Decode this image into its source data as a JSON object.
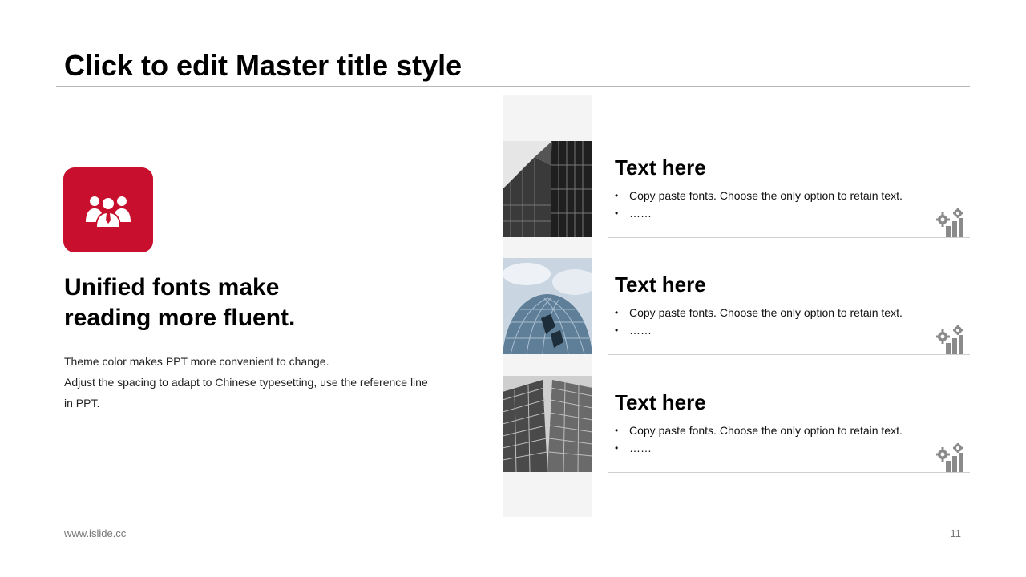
{
  "slide": {
    "title": "Click to edit Master title style",
    "accent_color": "#c8102e"
  },
  "feature": {
    "icon": "team-icon",
    "heading_lines": [
      "Unified fonts make",
      "reading more fluent."
    ],
    "body_lines": [
      "Theme color makes PPT more convenient to change.",
      "Adjust the spacing to adapt to Chinese typesetting, use the reference line",
      "in PPT."
    ]
  },
  "items": [
    {
      "title": "Text here",
      "bullets": [
        "Copy paste fonts. Choose the only option to retain text.",
        "……"
      ],
      "icon": "settings-chart-icon",
      "thumbnail": "building-photo"
    },
    {
      "title": "Text here",
      "bullets": [
        "Copy paste fonts. Choose the only option to retain text.",
        "……"
      ],
      "icon": "settings-chart-icon",
      "thumbnail": "glass-tower-photo"
    },
    {
      "title": "Text here",
      "bullets": [
        "Copy paste fonts. Choose the only option to retain text.",
        "……"
      ],
      "icon": "settings-chart-icon",
      "thumbnail": "facade-photo"
    }
  ],
  "footer": {
    "url": "www.islide.cc",
    "page_number": "11"
  }
}
